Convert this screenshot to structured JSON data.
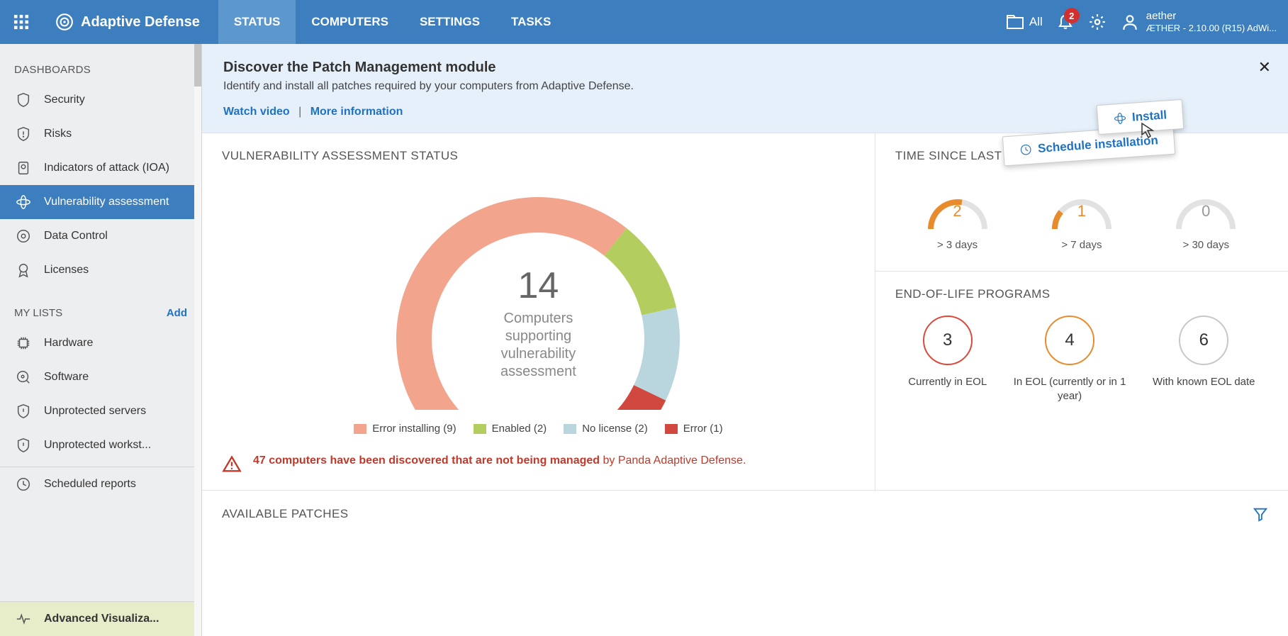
{
  "brand": "Adaptive Defense",
  "tabs": {
    "status": "STATUS",
    "computers": "COMPUTERS",
    "settings": "SETTINGS",
    "tasks": "TASKS"
  },
  "topbar": {
    "all": "All",
    "notif_count": "2",
    "user_name": "aether",
    "user_version": "ÆTHER - 2.10.00 (R15) AdWi..."
  },
  "sidebar": {
    "dashboards_title": "DASHBOARDS",
    "items": [
      {
        "label": "Security"
      },
      {
        "label": "Risks"
      },
      {
        "label": "Indicators of attack (IOA)"
      },
      {
        "label": "Vulnerability assessment"
      },
      {
        "label": "Data Control"
      },
      {
        "label": "Licenses"
      }
    ],
    "mylists_title": "MY LISTS",
    "add": "Add",
    "lists": [
      {
        "label": "Hardware"
      },
      {
        "label": "Software"
      },
      {
        "label": "Unprotected servers"
      },
      {
        "label": "Unprotected workst..."
      }
    ],
    "scheduled": "Scheduled reports",
    "adv": "Advanced Visualiza..."
  },
  "banner": {
    "title": "Discover the Patch Management module",
    "subtitle": "Identify and install all patches required by your computers from Adaptive Defense.",
    "watch": "Watch video",
    "more": "More information",
    "install": "Install",
    "schedule": "Schedule installation"
  },
  "vuln": {
    "title": "VULNERABILITY ASSESSMENT STATUS",
    "count": "14",
    "label_l1": "Computers",
    "label_l2": "supporting",
    "label_l3": "vulnerability",
    "label_l4": "assessment",
    "legend": [
      {
        "label": "Error installing (9)",
        "color": "#f2a48d"
      },
      {
        "label": "Enabled (2)",
        "color": "#b4cd5f"
      },
      {
        "label": "No license (2)",
        "color": "#b9d5de"
      },
      {
        "label": "Error (1)",
        "color": "#d1483f"
      }
    ],
    "warn_bold": "47 computers have been discovered that are not being managed",
    "warn_rest": " by Panda Adaptive Defense."
  },
  "time": {
    "title": "TIME SINCE LAST CHECK",
    "items": [
      {
        "val": "2",
        "sub": "> 3 days",
        "orange": true,
        "frac": 0.55
      },
      {
        "val": "1",
        "sub": "> 7 days",
        "orange": true,
        "frac": 0.22
      },
      {
        "val": "0",
        "sub": "> 30 days",
        "orange": false,
        "frac": 0
      }
    ]
  },
  "eol": {
    "title": "END-OF-LIFE PROGRAMS",
    "items": [
      {
        "val": "3",
        "cap": "Currently in EOL",
        "color": "#d94a3d"
      },
      {
        "val": "4",
        "cap": "In EOL (currently or in 1 year)",
        "color": "#e88b2d"
      },
      {
        "val": "6",
        "cap": "With known EOL date",
        "color": "#c8c8c8"
      }
    ]
  },
  "patches": {
    "title": "AVAILABLE PATCHES"
  },
  "chart_data": {
    "type": "pie",
    "title": "Vulnerability Assessment Status",
    "total": 14,
    "series": [
      {
        "name": "Error installing",
        "value": 9,
        "color": "#f2a48d"
      },
      {
        "name": "Enabled",
        "value": 2,
        "color": "#b4cd5f"
      },
      {
        "name": "No license",
        "value": 2,
        "color": "#b9d5de"
      },
      {
        "name": "Error",
        "value": 1,
        "color": "#d1483f"
      }
    ]
  }
}
